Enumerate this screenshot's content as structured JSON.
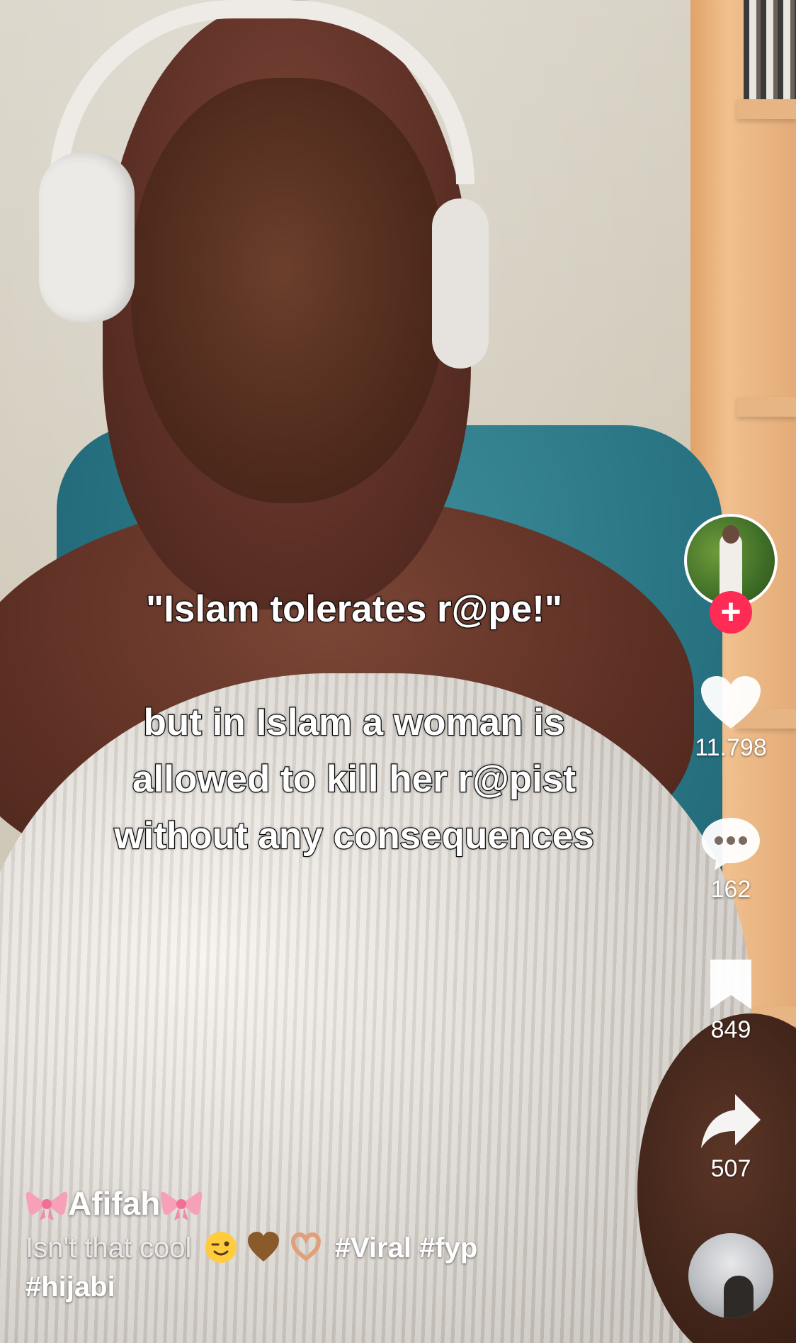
{
  "caption": {
    "line1": "\"Islam tolerates r@pe!\"",
    "line2": "but in Islam a woman is",
    "line3": "allowed to kill her r@pist",
    "line4": "without any consequences"
  },
  "rail": {
    "follow_symbol": "+",
    "likes": "11.798",
    "comments": "162",
    "saves": "849",
    "shares": "507"
  },
  "post": {
    "author": "Afifah",
    "description": "Isn't that cool",
    "hashtag_1": "#Viral",
    "hashtag_2": "#fyp",
    "hashtag_3": "#hijabi"
  },
  "icons": {
    "like": "heart-icon",
    "comment": "comment-bubble-icon",
    "save": "bookmark-icon",
    "share": "share-arrow-icon",
    "author_decoration": "pink-bow-emoji",
    "desc_emojis": [
      "winking-face-emoji",
      "brown-heart-emoji",
      "heart-hands-emoji"
    ]
  },
  "colors": {
    "follow_button": "#fe2c55",
    "text": "#ffffff"
  }
}
